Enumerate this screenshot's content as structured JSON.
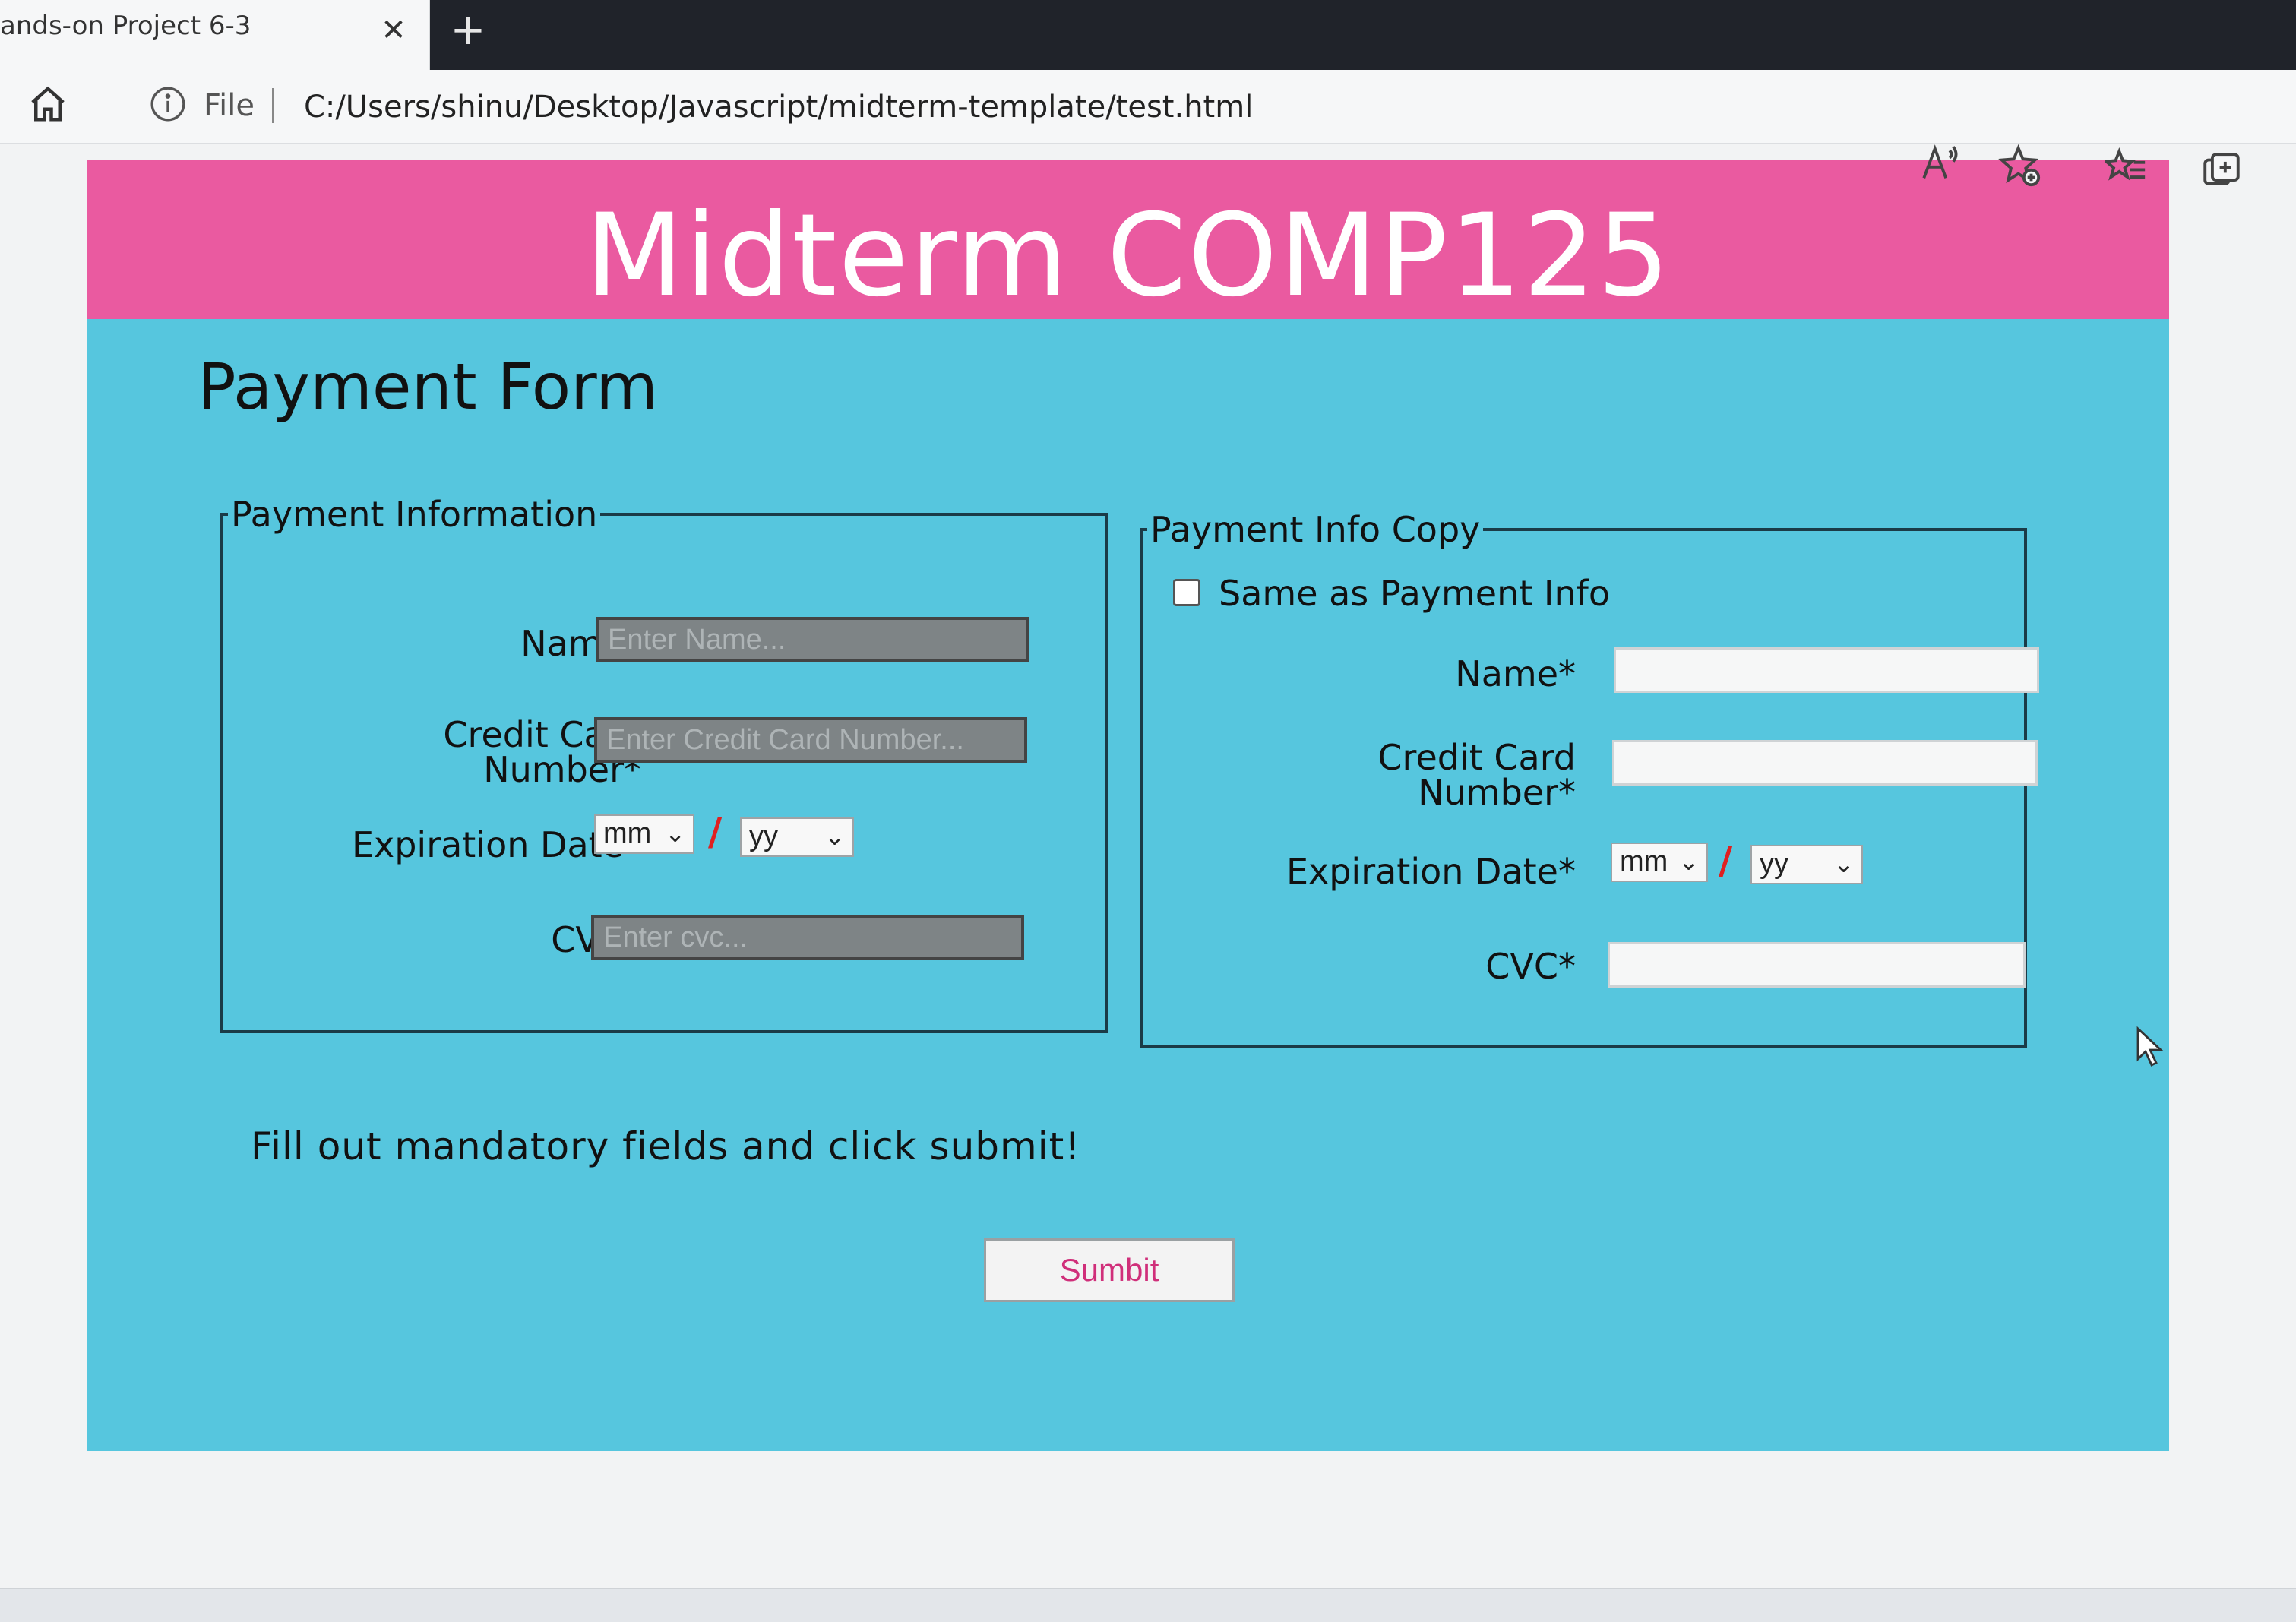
{
  "browser": {
    "tab": {
      "title": "ands-on Project 6-3",
      "close_glyph": "✕"
    },
    "new_tab_glyph": "+",
    "address": {
      "scheme_label": "File",
      "url": "C:/Users/shinu/Desktop/Javascript/midterm-template/test.html"
    },
    "toolbar_icons": [
      "read-aloud-icon",
      "add-favorite-icon",
      "favorites-icon",
      "collections-icon"
    ]
  },
  "page": {
    "banner_title": "Midterm COMP125",
    "heading": "Payment Form",
    "payment_info": {
      "legend": "Payment Information",
      "name_label": "Name*",
      "name_placeholder": "Enter Name...",
      "card_label_line1": "Credit Card",
      "card_label_line2": "Number*",
      "card_placeholder": "Enter Credit Card Number...",
      "exp_label": "Expiration Date*",
      "exp_month": "mm",
      "exp_separator": "/",
      "exp_year": "yy",
      "cvc_label": "CVC*",
      "cvc_placeholder": "Enter cvc..."
    },
    "payment_copy": {
      "legend": "Payment Info Copy",
      "same_as_label": "Same as Payment Info",
      "same_as_checked": false,
      "name_label": "Name*",
      "card_label_line1": "Credit Card",
      "card_label_line2": "Number*",
      "exp_label": "Expiration Date*",
      "exp_month": "mm",
      "exp_separator": "/",
      "exp_year": "yy",
      "cvc_label": "CVC*"
    },
    "instruction": "Fill out mandatory fields and click submit!",
    "submit_label": "Sumbit"
  },
  "colors": {
    "banner": "#ea5aa0",
    "background": "#56c6de",
    "gray_input": "#7e8486",
    "submit_text": "#d02f7a",
    "separator": "#e02020"
  }
}
